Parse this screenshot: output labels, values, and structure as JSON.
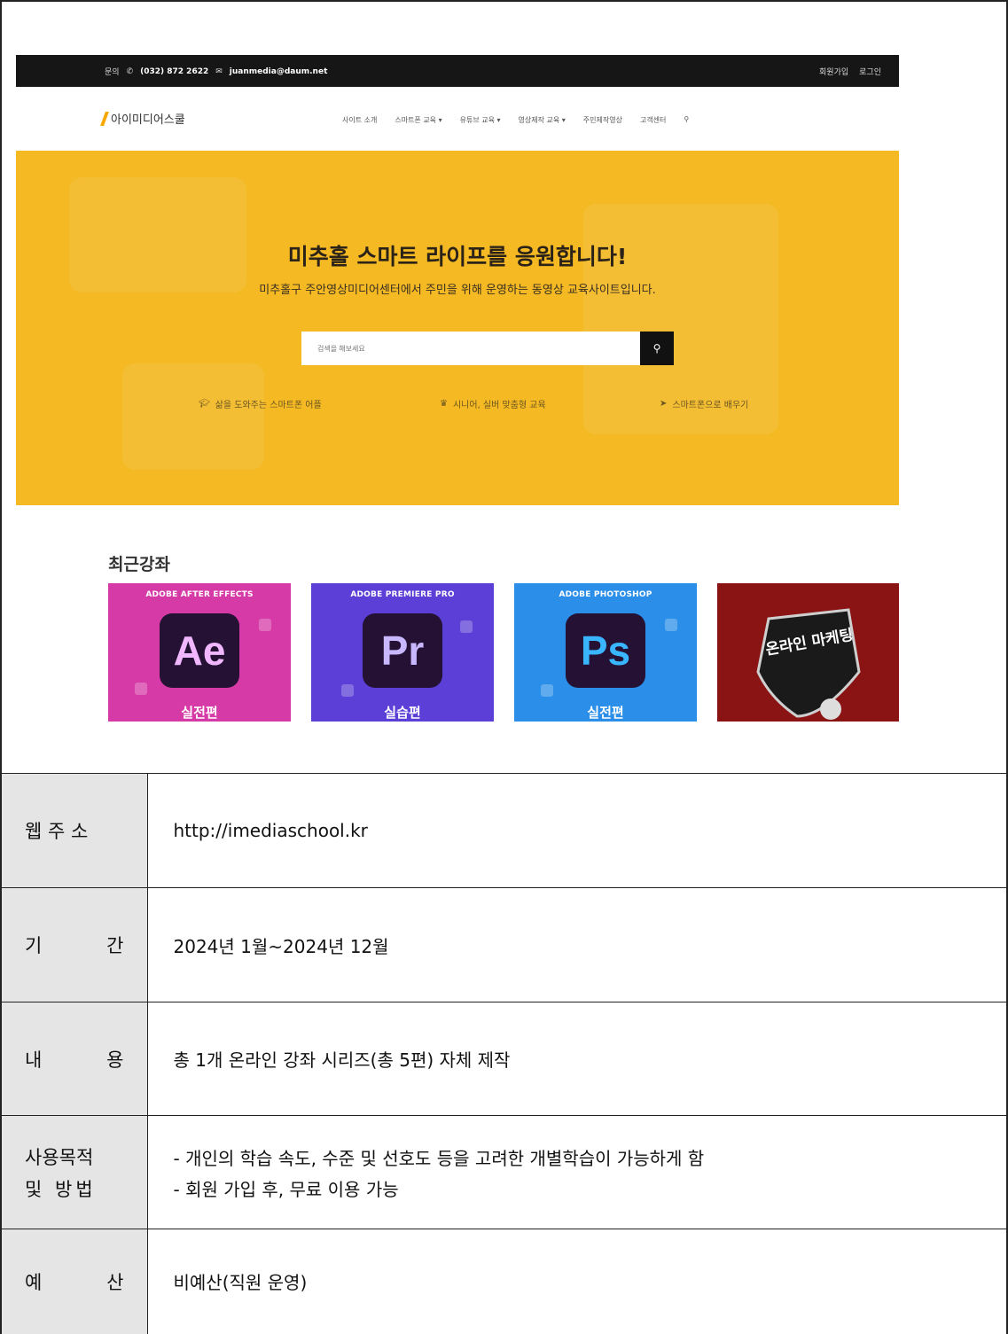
{
  "screenshot": {
    "topbar": {
      "contact_label": "문의",
      "phone": "(032) 872 2622",
      "email": "juanmedia@daum.net",
      "signup": "회원가입",
      "login": "로그인"
    },
    "logo_text": "아이미디어스쿨",
    "menu": [
      "사이트 소개",
      "스마트폰 교육 ▾",
      "유튜브 교육 ▾",
      "영상제작 교육 ▾",
      "주민제작영상",
      "고객센터"
    ],
    "hero": {
      "title": "미추홀 스마트 라이프를 응원합니다!",
      "subtitle": "미추홀구 주안영상미디어센터에서 주민을 위해 운영하는 동영상 교육사이트입니다.",
      "search_placeholder": "검색을 해보세요",
      "features": [
        "삶을 도와주는 스마트폰 어플",
        "시니어, 실버 맞춤형 교육",
        "스마트폰으로 배우기"
      ]
    },
    "recent_title": "최근강좌",
    "cards": [
      {
        "caption": "ADOBE AFTER EFFECTS",
        "icon": "Ae",
        "footer": "실전편",
        "bg": "#d63aa6",
        "fg": "#f0b7ff"
      },
      {
        "caption": "ADOBE PREMIERE PRO",
        "icon": "Pr",
        "footer": "실습편",
        "bg": "#5b3fd6",
        "fg": "#c9b8ff"
      },
      {
        "caption": "ADOBE PHOTOSHOP",
        "icon": "Ps",
        "footer": "실전편",
        "bg": "#2b8ee8",
        "fg": "#39b6ff"
      },
      {
        "caption": "",
        "icon": "온라인 마케팅",
        "footer": "",
        "bg": "#8a1414",
        "fg": "#ffffff"
      }
    ]
  },
  "info": {
    "url_label": "웹 주 소",
    "url": "http://imediaschool.kr",
    "period_label_a": "기",
    "period_label_b": "간",
    "period": "2024년 1월~2024년 12월",
    "content_label_a": "내",
    "content_label_b": "용",
    "content": "총 1개 온라인 강좌 시리즈(총 5편) 자체 제작",
    "purpose_label_1": "사용목적",
    "purpose_label_2": "및 방법",
    "purpose_1": "- 개인의 학습 속도, 수준 및 선호도 등을 고려한 개별학습이 가능하게 함",
    "purpose_2": "- 회원 가입 후, 무료 이용 가능",
    "budget_label_a": "예",
    "budget_label_b": "산",
    "budget": "비예산(직원 운영)"
  }
}
